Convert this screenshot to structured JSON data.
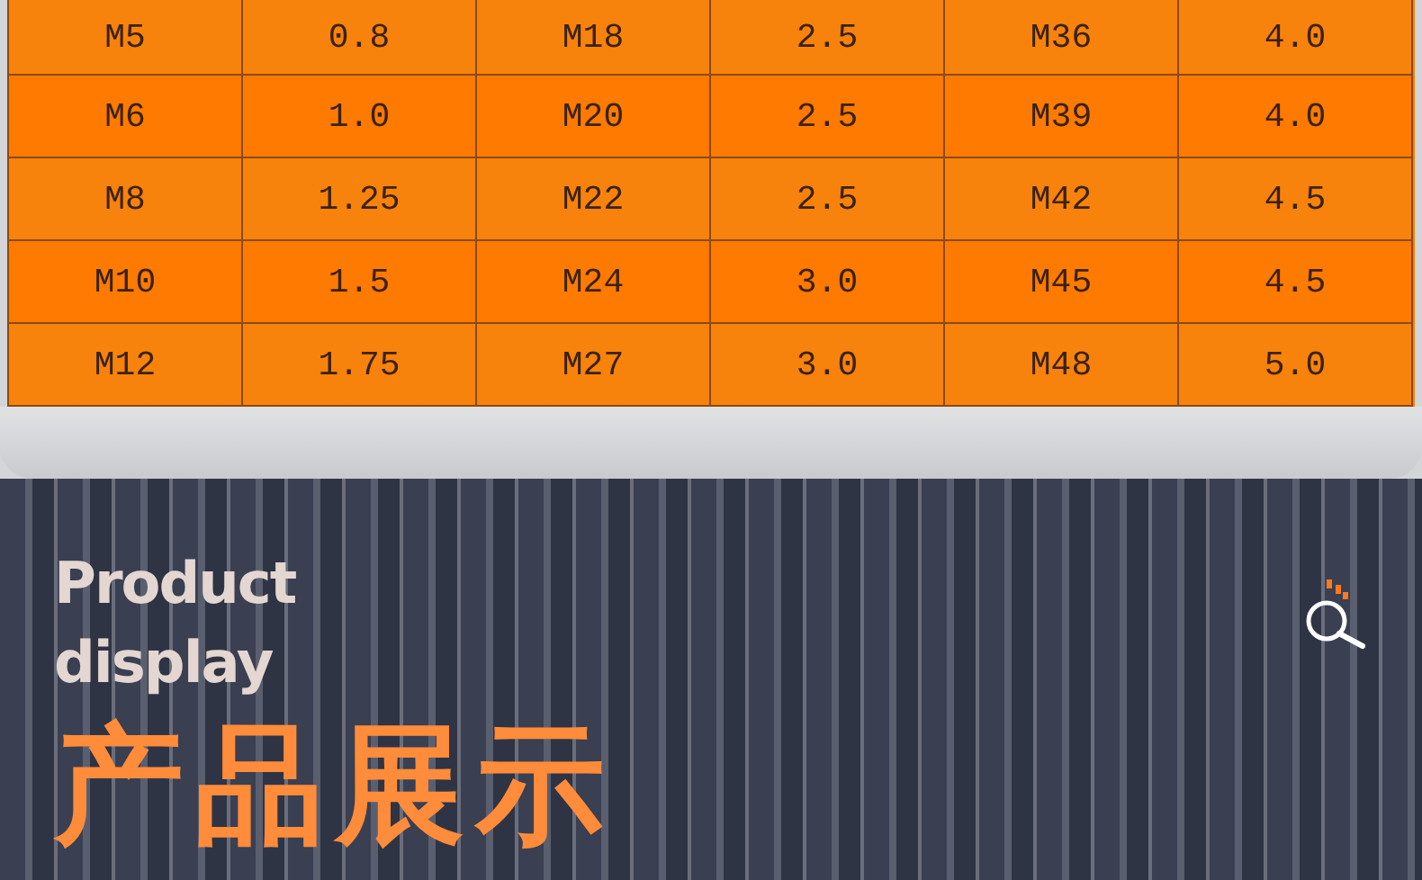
{
  "table": {
    "rows": [
      {
        "cells": [
          "M5",
          "0.8",
          "M18",
          "2.5",
          "M36",
          "4.0"
        ]
      },
      {
        "cells": [
          "M6",
          "1.0",
          "M20",
          "2.5",
          "M39",
          "4.0"
        ]
      },
      {
        "cells": [
          "M8",
          "1.25",
          "M22",
          "2.5",
          "M42",
          "4.5"
        ]
      },
      {
        "cells": [
          "M10",
          "1.5",
          "M24",
          "3.0",
          "M45",
          "4.5"
        ]
      },
      {
        "cells": [
          "M12",
          "1.75",
          "M27",
          "3.0",
          "M48",
          "5.0"
        ]
      }
    ]
  },
  "section": {
    "title_en_lines": [
      "Product",
      "display"
    ],
    "title_zh": "产品展示"
  }
}
